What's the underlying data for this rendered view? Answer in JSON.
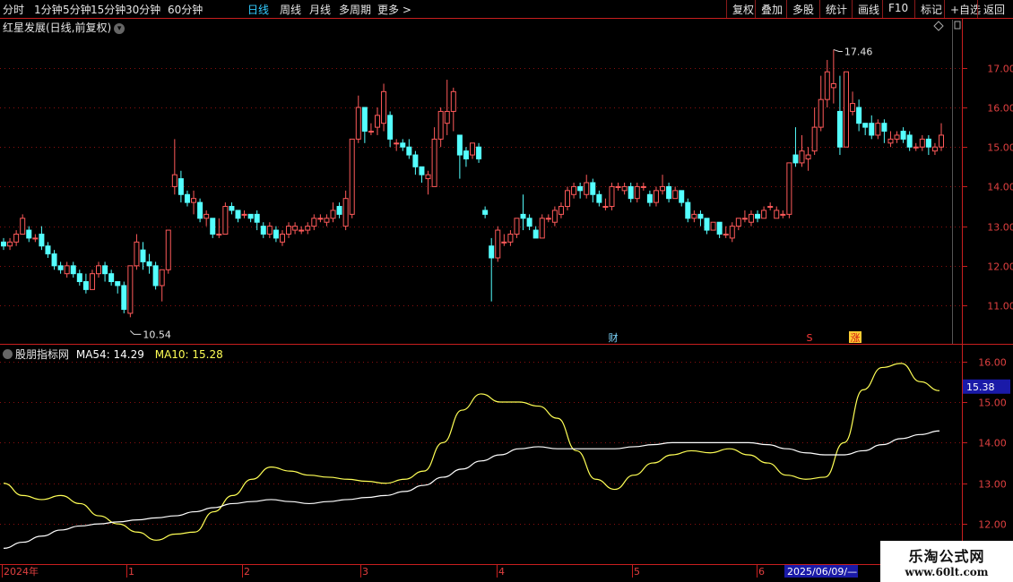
{
  "toolbar": {
    "left_items": [
      "分时",
      "1分钟",
      "5分钟",
      "15分钟",
      "30分钟",
      "60分钟",
      "日线",
      "周线",
      "月线",
      "多周期",
      "更多 >"
    ],
    "active_index": 6,
    "right_items": [
      "复权",
      "叠加",
      "多股",
      "统计",
      "画线",
      "F10",
      "标记",
      "+自选",
      "返回"
    ]
  },
  "chart_title": "红星发展(日线,前复权)",
  "indicator": {
    "name": "股朋指标网",
    "ma54_label": "MA54: 14.29",
    "ma10_label": "MA10: 15.28",
    "current_value": "15.38"
  },
  "markers": {
    "high": "17.46",
    "low": "10.54",
    "cai": "财",
    "s": "S",
    "tag": "涨"
  },
  "date_axis": {
    "labels": [
      "2024年",
      "1",
      "2",
      "3",
      "4",
      "5",
      "6"
    ],
    "cursor_date": "2025/06/09/—"
  },
  "watermark": {
    "line1": "乐淘公式网",
    "line2": "www.60lt.com"
  },
  "colors": {
    "up": "#ff5a5a",
    "down": "#54ffff",
    "ma10": "#ffff55",
    "ma54": "#ffffff",
    "axis": "#c81e1e"
  },
  "chart_data": [
    {
      "type": "candlestick",
      "title": "红星发展(日线,前复权)",
      "y_axis_ticks": [
        11.0,
        12.0,
        13.0,
        14.0,
        15.0,
        16.0,
        17.0
      ],
      "ylim": [
        10.3,
        17.9
      ],
      "max_label": 17.46,
      "min_label": 10.54,
      "candles": [
        [
          12.6,
          12.5,
          12.4,
          12.7
        ],
        [
          12.5,
          12.6,
          12.4,
          12.7
        ],
        [
          12.6,
          12.8,
          12.5,
          12.9
        ],
        [
          12.8,
          13.2,
          12.8,
          13.3
        ],
        [
          12.9,
          12.7,
          12.6,
          13.0
        ],
        [
          12.7,
          12.7,
          12.6,
          12.8
        ],
        [
          12.8,
          12.5,
          12.4,
          13.0
        ],
        [
          12.5,
          12.3,
          12.2,
          12.6
        ],
        [
          12.3,
          12.0,
          11.9,
          12.4
        ],
        [
          12.0,
          11.9,
          11.8,
          12.1
        ],
        [
          11.8,
          12.0,
          11.7,
          12.1
        ],
        [
          12.0,
          11.8,
          11.7,
          12.1
        ],
        [
          11.8,
          11.6,
          11.5,
          11.9
        ],
        [
          11.6,
          11.4,
          11.3,
          11.8
        ],
        [
          11.4,
          11.8,
          11.4,
          11.9
        ],
        [
          11.8,
          12.0,
          11.7,
          12.1
        ],
        [
          12.0,
          11.8,
          11.6,
          12.1
        ],
        [
          11.8,
          11.6,
          11.5,
          11.9
        ],
        [
          11.6,
          11.5,
          11.3,
          11.6
        ],
        [
          11.5,
          10.9,
          10.8,
          11.6
        ],
        [
          10.8,
          12.0,
          10.7,
          12.0
        ],
        [
          12.0,
          12.6,
          11.9,
          12.8
        ],
        [
          12.4,
          12.1,
          11.9,
          12.6
        ],
        [
          12.1,
          12.0,
          11.8,
          12.3
        ],
        [
          12.0,
          11.5,
          11.4,
          12.1
        ],
        [
          11.5,
          11.9,
          11.1,
          11.9
        ],
        [
          11.9,
          12.9,
          11.8,
          12.9
        ],
        [
          14.0,
          14.3,
          13.8,
          15.2
        ],
        [
          14.2,
          13.8,
          13.6,
          14.4
        ],
        [
          13.8,
          13.6,
          13.5,
          13.9
        ],
        [
          13.6,
          13.7,
          13.3,
          13.9
        ],
        [
          13.6,
          13.2,
          13.1,
          13.7
        ],
        [
          13.2,
          13.3,
          13.0,
          13.4
        ],
        [
          13.2,
          12.8,
          12.7,
          13.2
        ],
        [
          12.8,
          12.8,
          12.7,
          13.2
        ],
        [
          12.8,
          13.5,
          12.8,
          13.6
        ],
        [
          13.5,
          13.4,
          13.3,
          13.6
        ],
        [
          13.4,
          13.2,
          13.1,
          13.4
        ],
        [
          13.3,
          13.3,
          13.2,
          13.4
        ],
        [
          13.3,
          13.2,
          13.1,
          13.3
        ],
        [
          13.3,
          13.1,
          12.9,
          13.4
        ],
        [
          13.0,
          12.8,
          12.7,
          13.1
        ],
        [
          12.8,
          13.0,
          12.7,
          13.1
        ],
        [
          12.9,
          12.7,
          12.6,
          13.0
        ],
        [
          12.6,
          12.8,
          12.5,
          12.9
        ],
        [
          12.8,
          13.0,
          12.7,
          13.1
        ],
        [
          12.9,
          13.0,
          12.8,
          13.1
        ],
        [
          12.9,
          12.9,
          12.8,
          13.0
        ],
        [
          12.9,
          13.0,
          12.8,
          13.1
        ],
        [
          13.0,
          13.2,
          12.9,
          13.3
        ],
        [
          13.2,
          13.2,
          13.1,
          13.3
        ],
        [
          13.1,
          13.2,
          13.0,
          13.3
        ],
        [
          13.2,
          13.4,
          13.1,
          13.6
        ],
        [
          13.5,
          13.3,
          13.2,
          13.6
        ],
        [
          13.0,
          13.7,
          12.9,
          13.9
        ],
        [
          13.3,
          15.2,
          13.2,
          15.2
        ],
        [
          15.2,
          16.0,
          15.1,
          16.3
        ],
        [
          16.0,
          15.4,
          15.1,
          16.0
        ],
        [
          15.4,
          15.4,
          15.3,
          15.6
        ],
        [
          15.5,
          15.8,
          15.3,
          16.0
        ],
        [
          15.6,
          16.4,
          15.4,
          16.6
        ],
        [
          15.8,
          15.2,
          15.0,
          15.9
        ],
        [
          15.1,
          15.1,
          14.9,
          15.2
        ],
        [
          15.1,
          15.0,
          14.9,
          15.2
        ],
        [
          15.0,
          14.8,
          14.7,
          15.2
        ],
        [
          14.8,
          14.5,
          14.3,
          14.9
        ],
        [
          14.5,
          14.3,
          14.1,
          14.5
        ],
        [
          14.2,
          14.3,
          13.8,
          14.4
        ],
        [
          14.0,
          15.2,
          14.0,
          15.5
        ],
        [
          15.2,
          15.9,
          15.0,
          16.0
        ],
        [
          15.6,
          15.9,
          15.3,
          16.7
        ],
        [
          15.9,
          16.4,
          15.4,
          16.5
        ],
        [
          15.3,
          14.8,
          14.2,
          15.3
        ],
        [
          14.9,
          14.7,
          14.5,
          15.0
        ],
        [
          14.8,
          15.1,
          14.7,
          15.1
        ],
        [
          15.0,
          14.7,
          14.6,
          15.1
        ],
        [
          13.4,
          13.3,
          13.2,
          13.5
        ],
        [
          12.5,
          12.2,
          11.1,
          12.7
        ],
        [
          12.2,
          12.9,
          12.1,
          13.0
        ],
        [
          12.6,
          12.6,
          12.5,
          12.8
        ],
        [
          12.6,
          12.8,
          12.5,
          12.9
        ],
        [
          12.8,
          13.2,
          12.7,
          13.2
        ],
        [
          13.3,
          13.2,
          12.9,
          13.8
        ],
        [
          13.2,
          13.0,
          12.9,
          13.3
        ],
        [
          12.9,
          12.7,
          12.7,
          13.0
        ],
        [
          12.7,
          13.2,
          12.7,
          13.3
        ],
        [
          13.2,
          13.2,
          13.1,
          13.3
        ],
        [
          13.1,
          13.4,
          13.0,
          13.5
        ],
        [
          13.3,
          13.5,
          13.2,
          13.6
        ],
        [
          13.5,
          13.9,
          13.4,
          14.0
        ],
        [
          13.8,
          14.0,
          13.7,
          14.1
        ],
        [
          14.0,
          13.9,
          13.7,
          14.1
        ],
        [
          13.8,
          14.1,
          13.7,
          14.3
        ],
        [
          14.1,
          13.8,
          13.6,
          14.2
        ],
        [
          13.8,
          13.6,
          13.5,
          13.9
        ],
        [
          13.5,
          13.5,
          13.4,
          13.7
        ],
        [
          13.5,
          14.0,
          13.4,
          14.1
        ],
        [
          14.0,
          14.0,
          13.9,
          14.1
        ],
        [
          13.9,
          14.0,
          13.8,
          14.1
        ],
        [
          14.0,
          13.7,
          13.6,
          14.1
        ],
        [
          13.7,
          14.0,
          13.6,
          14.1
        ],
        [
          14.0,
          14.0,
          13.9,
          14.1
        ],
        [
          13.8,
          13.6,
          13.5,
          13.9
        ],
        [
          13.6,
          13.9,
          13.5,
          14.0
        ],
        [
          13.9,
          14.0,
          13.8,
          14.3
        ],
        [
          14.0,
          13.7,
          13.6,
          14.1
        ],
        [
          13.7,
          13.9,
          13.7,
          14.0
        ],
        [
          13.9,
          13.6,
          13.5,
          13.9
        ],
        [
          13.6,
          13.2,
          13.1,
          13.7
        ],
        [
          13.2,
          13.3,
          13.1,
          13.4
        ],
        [
          13.3,
          13.2,
          13.0,
          13.4
        ],
        [
          13.2,
          12.9,
          12.8,
          13.2
        ],
        [
          12.9,
          13.1,
          12.9,
          13.1
        ],
        [
          13.1,
          12.8,
          12.7,
          13.1
        ],
        [
          12.8,
          12.8,
          12.7,
          13.0
        ],
        [
          12.7,
          13.0,
          12.6,
          13.1
        ],
        [
          13.0,
          13.2,
          12.9,
          13.2
        ],
        [
          13.2,
          13.2,
          13.1,
          13.4
        ],
        [
          13.1,
          13.3,
          13.0,
          13.4
        ],
        [
          13.3,
          13.2,
          13.1,
          13.4
        ],
        [
          13.2,
          13.4,
          13.2,
          13.5
        ],
        [
          13.5,
          13.5,
          13.4,
          13.6
        ],
        [
          13.2,
          13.4,
          13.2,
          13.5
        ],
        [
          13.3,
          13.3,
          13.2,
          13.4
        ],
        [
          13.3,
          14.6,
          13.2,
          14.6
        ],
        [
          14.8,
          14.6,
          14.5,
          15.5
        ],
        [
          14.6,
          14.9,
          14.5,
          15.3
        ],
        [
          14.7,
          14.8,
          14.4,
          15.0
        ],
        [
          14.9,
          15.5,
          14.8,
          16.0
        ],
        [
          15.5,
          16.2,
          15.4,
          16.8
        ],
        [
          16.2,
          16.9,
          16.0,
          17.2
        ],
        [
          16.5,
          16.6,
          16.1,
          17.46
        ],
        [
          15.9,
          15.0,
          14.8,
          16.8
        ],
        [
          15.0,
          16.9,
          15.0,
          16.9
        ],
        [
          15.9,
          16.1,
          15.8,
          16.4
        ],
        [
          16.0,
          15.6,
          15.4,
          16.2
        ],
        [
          15.6,
          15.5,
          15.3,
          15.6
        ],
        [
          15.6,
          15.3,
          15.2,
          15.8
        ],
        [
          15.3,
          15.6,
          15.2,
          15.7
        ],
        [
          15.6,
          15.4,
          15.1,
          15.7
        ],
        [
          15.1,
          15.2,
          15.0,
          15.4
        ],
        [
          15.2,
          15.3,
          15.1,
          15.4
        ],
        [
          15.4,
          15.2,
          15.1,
          15.5
        ],
        [
          15.3,
          15.0,
          14.9,
          15.4
        ],
        [
          15.0,
          15.0,
          14.9,
          15.1
        ],
        [
          15.0,
          15.2,
          14.9,
          15.3
        ],
        [
          15.2,
          15.0,
          14.8,
          15.3
        ],
        [
          14.9,
          15.0,
          14.8,
          15.1
        ],
        [
          15.0,
          15.3,
          14.9,
          15.6
        ]
      ]
    },
    {
      "type": "line",
      "title": "股朋指标网",
      "y_axis_ticks": [
        12.0,
        13.0,
        14.0,
        15.0,
        16.0
      ],
      "ylim": [
        11.1,
        16.3
      ],
      "series": [
        {
          "name": "MA10",
          "points": [
            13.0,
            12.7,
            12.6,
            12.7,
            12.5,
            12.2,
            12.0,
            11.8,
            11.6,
            11.75,
            11.8,
            12.3,
            12.7,
            13.1,
            13.4,
            13.3,
            13.2,
            13.15,
            13.1,
            13.05,
            13.0,
            13.1,
            13.3,
            14.0,
            14.8,
            15.2,
            15.0,
            15.0,
            14.9,
            14.6,
            13.8,
            13.1,
            12.85,
            13.2,
            13.5,
            13.7,
            13.8,
            13.75,
            13.85,
            13.7,
            13.5,
            13.2,
            13.1,
            13.15,
            14.0,
            15.3,
            15.85,
            15.95,
            15.5,
            15.28
          ]
        },
        {
          "name": "MA54",
          "points": [
            11.4,
            11.55,
            11.7,
            11.85,
            11.95,
            12.0,
            12.05,
            12.1,
            12.15,
            12.2,
            12.3,
            12.4,
            12.5,
            12.55,
            12.6,
            12.55,
            12.5,
            12.55,
            12.6,
            12.65,
            12.7,
            12.8,
            12.95,
            13.15,
            13.35,
            13.55,
            13.7,
            13.85,
            13.9,
            13.85,
            13.85,
            13.85,
            13.85,
            13.9,
            13.95,
            14.0,
            14.0,
            14.0,
            14.0,
            14.0,
            13.95,
            13.85,
            13.75,
            13.7,
            13.7,
            13.8,
            13.95,
            14.1,
            14.2,
            14.29
          ]
        }
      ]
    }
  ]
}
